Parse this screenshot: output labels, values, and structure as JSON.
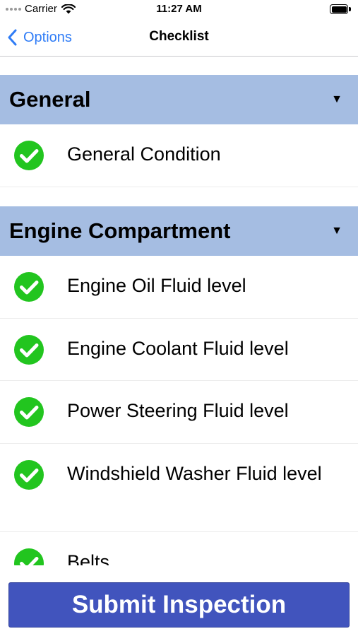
{
  "status_bar": {
    "carrier": "Carrier",
    "time": "11:27 AM"
  },
  "nav": {
    "back_label": "Options",
    "title": "Checklist"
  },
  "sections": [
    {
      "title": "General",
      "toggle": "▼",
      "items": [
        {
          "label": "General Condition",
          "checked": true
        }
      ]
    },
    {
      "title": "Engine Compartment",
      "toggle": "▼",
      "items": [
        {
          "label": "Engine Oil Fluid level",
          "checked": true
        },
        {
          "label": "Engine Coolant Fluid level",
          "checked": true
        },
        {
          "label": "Power Steering Fluid level",
          "checked": true
        },
        {
          "label": "Windshield Washer Fluid level",
          "checked": true
        },
        {
          "label": "Belts",
          "checked": true
        }
      ]
    }
  ],
  "submit_label": "Submit Inspection",
  "colors": {
    "accent": "#2f7cf6",
    "section_bg": "#a5bde2",
    "check": "#22c51f",
    "submit_bg": "#4154bd"
  }
}
